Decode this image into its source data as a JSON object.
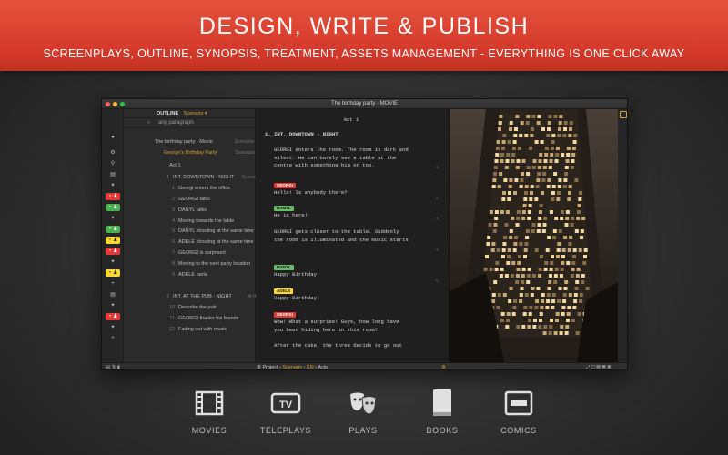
{
  "banner": {
    "title": "DESIGN, WRITE & PUBLISH",
    "subtitle": "SCREENPLAYS, OUTLINE, SYNOPSIS, TREATMENT, ASSETS MANAGEMENT - EVERYTHING IS ONE CLICK AWAY"
  },
  "window": {
    "title": "The birthday party - MOVIE"
  },
  "outline": {
    "header": "OUTLINE",
    "mode": "Scenario ▾",
    "search_placeholder": "any paragraph",
    "rows": [
      {
        "num": "",
        "text": "The birthday party - Movie",
        "hint": "Scenario",
        "lang": ""
      },
      {
        "num": "",
        "text": "George's Birthday Party",
        "hint": "Scenario",
        "lang": "ENGLISH"
      },
      {
        "num": "",
        "text": "Act 1",
        "hint": "",
        "lang": ""
      },
      {
        "num": "1",
        "text": "INT.  DOWNTOWN - NIGHT",
        "hint": "Scene 1",
        "lang": ""
      },
      {
        "num": "1",
        "text": "Georgi enters the office",
        "hint": "",
        "lang": ""
      },
      {
        "num": "2",
        "text": "GEORGI talks",
        "hint": "",
        "lang": ""
      },
      {
        "num": "3",
        "text": "DANYL talks",
        "hint": "",
        "lang": ""
      },
      {
        "num": "4",
        "text": "Moving towards the table",
        "hint": "",
        "lang": ""
      },
      {
        "num": "5",
        "text": "DANYL shouting at the same time",
        "hint": "",
        "lang": ""
      },
      {
        "num": "6",
        "text": "ADELE shouting at the same time",
        "hint": "",
        "lang": ""
      },
      {
        "num": "7",
        "text": "GEORGI is surprised",
        "hint": "",
        "lang": ""
      },
      {
        "num": "8",
        "text": "Moving to the next party location",
        "hint": "",
        "lang": ""
      },
      {
        "num": "9",
        "text": "ADELE parla",
        "hint": "",
        "lang": ""
      },
      {
        "num": "2",
        "text": "INT.  AT THE PUB - NIGHT",
        "hint": "At the pub",
        "lang": ""
      },
      {
        "num": "10",
        "text": "Describe the pub",
        "hint": "",
        "lang": ""
      },
      {
        "num": "11",
        "text": "GEORGI thanks his friends",
        "hint": "",
        "lang": ""
      },
      {
        "num": "12",
        "text": "Fading out with music",
        "hint": "",
        "lang": ""
      }
    ]
  },
  "script": {
    "act": "Act 1",
    "heading": "1.  INT. DOWNTOWN - NIGHT",
    "action1": [
      "GEORGI enters the room. The room is dark and",
      "silent. He can barely see a table at the",
      "centre with something big on top."
    ],
    "chars": [
      "GEORGI",
      "DANYL",
      "DANYL",
      "ADELE",
      "GEORGI"
    ],
    "dialogue": [
      "Hello! Is anybody there?",
      "He is here!",
      "Happy Birthday!",
      "Happy Birthday!"
    ],
    "action2": [
      "GEORGI gets closer to the table. Suddenly",
      "the room is illuminated and the music starts"
    ],
    "last_dialogue": [
      "Wow! What a surprise! Guys, how long have",
      "you been hiding here in this room?"
    ],
    "action3": "After the cake, the three decide to go out",
    "line_numbers": [
      "1",
      "2",
      "3",
      "4",
      "5"
    ]
  },
  "statusbar": {
    "project": "Project",
    "scenario": "Scenario",
    "lang": "EN",
    "acts": "Acts"
  },
  "formats": [
    {
      "label": "MOVIES",
      "icon": "film-icon"
    },
    {
      "label": "TELEPLAYS",
      "icon": "tv-icon"
    },
    {
      "label": "PLAYS",
      "icon": "theater-masks-icon"
    },
    {
      "label": "BOOKS",
      "icon": "book-icon"
    },
    {
      "label": "COMICS",
      "icon": "comic-panel-icon"
    }
  ],
  "colors": {
    "banner": "#d53a2b",
    "accent": "#d8a032",
    "chip_red": "#e53935",
    "chip_green": "#66bb6a",
    "chip_yellow": "#fdd835"
  }
}
